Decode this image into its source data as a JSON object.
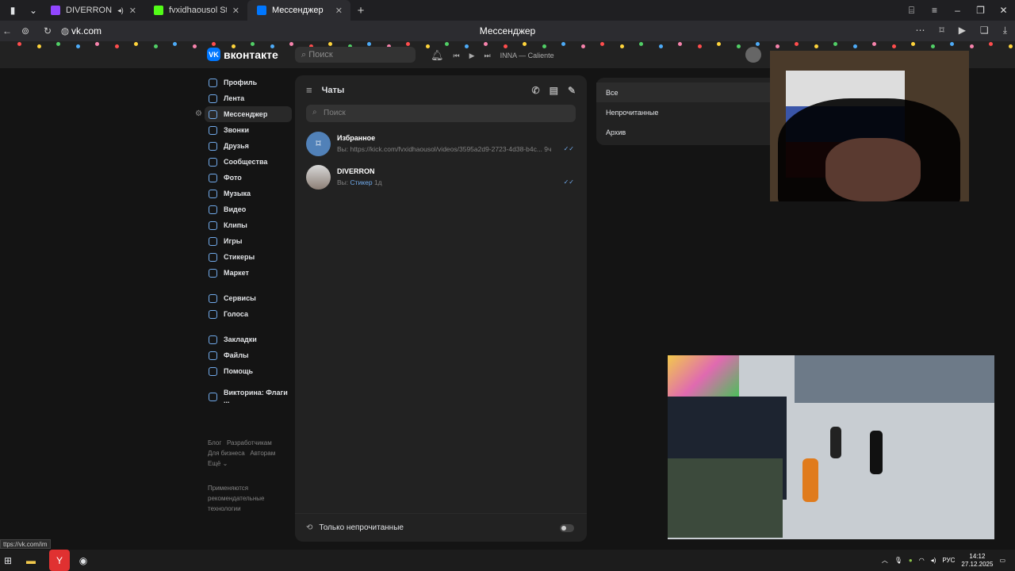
{
  "browser": {
    "tabs": [
      {
        "label": "DIVERRON - Twitch",
        "color": "#9146ff"
      },
      {
        "label": "fvxidhaousol Stream - Wa",
        "color": "#53fc18"
      },
      {
        "label": "Мессенджер",
        "color": "#0077ff"
      }
    ],
    "url": "vk.com",
    "page_title": "Мессенджер",
    "status_url": "ttps://vk.com/im"
  },
  "vk": {
    "logo": "вконтакте",
    "search_placeholder": "Поиск",
    "now_playing": "INNA — Caliente",
    "nav": [
      "Профиль",
      "Лента",
      "Мессенджер",
      "Звонки",
      "Друзья",
      "Сообщества",
      "Фото",
      "Музыка",
      "Видео",
      "Клипы",
      "Игры",
      "Стикеры",
      "Маркет"
    ],
    "nav2": [
      "Сервисы",
      "Голоса"
    ],
    "nav3": [
      "Закладки",
      "Файлы",
      "Помощь"
    ],
    "nav4": [
      "Викторина: Флаги ..."
    ],
    "footer": {
      "line1a": "Блог",
      "line1b": "Разработчикам",
      "line2a": "Для бизнеса",
      "line2b": "Авторам",
      "line3": "Ещё",
      "rec": "Применяются рекомендательные технологии"
    }
  },
  "chats": {
    "title": "Чаты",
    "search_placeholder": "Поиск",
    "items": [
      {
        "name": "Избранное",
        "prefix": "Вы: ",
        "message": "https://kick.com/fvxidhaousol/videos/3595a2d9-2723-4d38-b4c...",
        "time": "9ч"
      },
      {
        "name": "DIVERRON",
        "prefix": "Вы: ",
        "message": "Стикер",
        "time": "1д"
      }
    ],
    "unread_only": "Только непрочитанные"
  },
  "filters": [
    "Все",
    "Непрочитанные",
    "Архив"
  ],
  "taskbar": {
    "lang": "РУС",
    "time": "14:12",
    "date": "27.12.2025"
  }
}
